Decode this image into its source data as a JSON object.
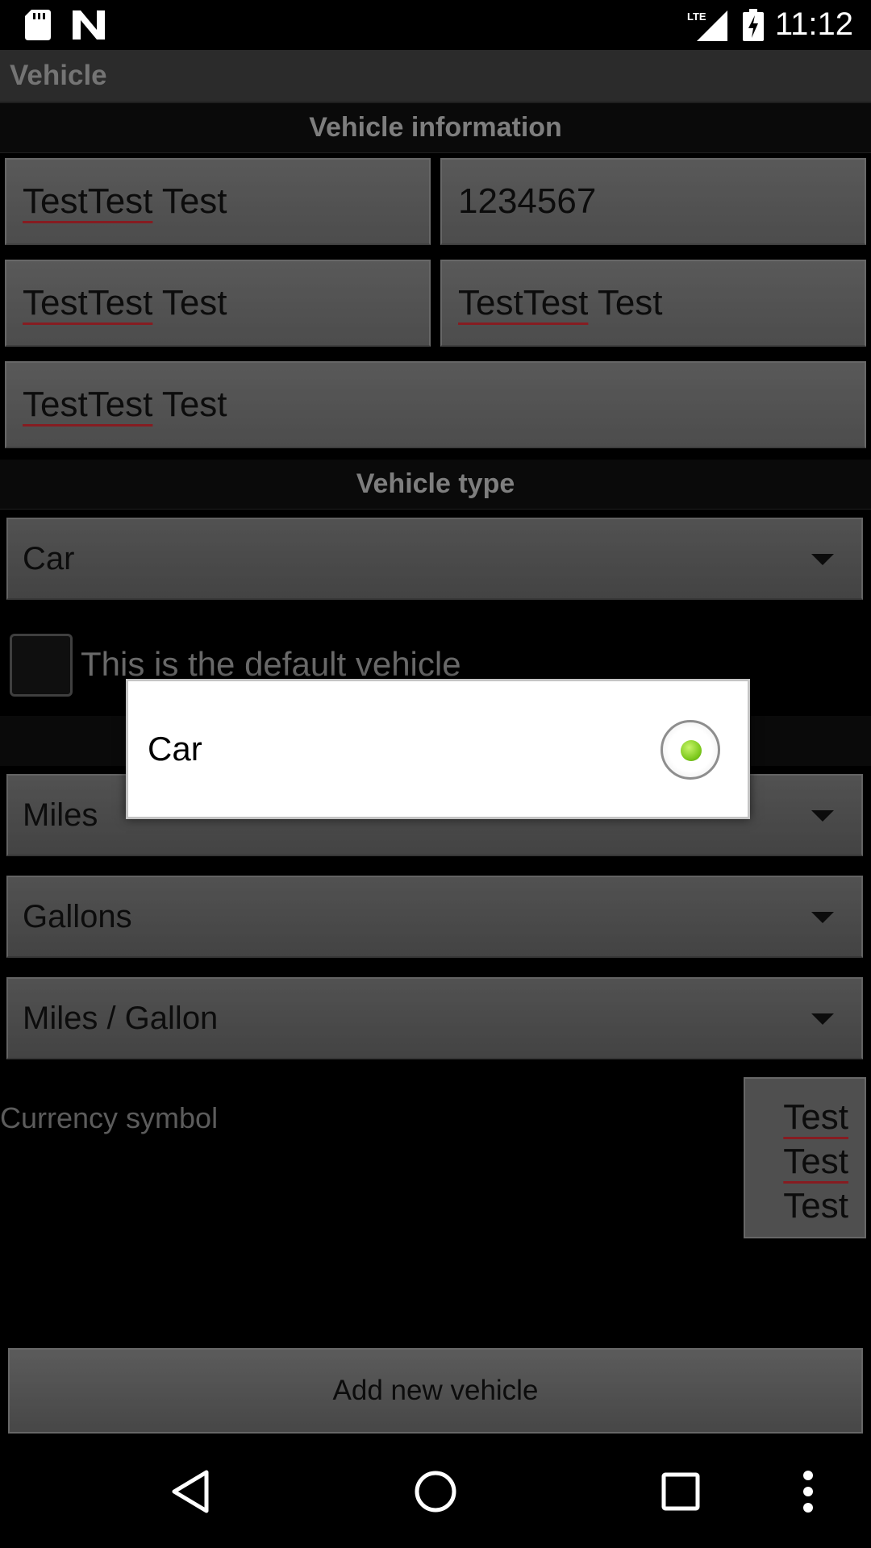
{
  "status_bar": {
    "time": "11:12",
    "network_label": "LTE",
    "icons": [
      "sd-card-icon",
      "n-logo-icon",
      "lte-signal-icon",
      "battery-charging-icon"
    ]
  },
  "action_bar": {
    "title": "Vehicle"
  },
  "vehicle_information": {
    "header": "Vehicle information",
    "fields": [
      {
        "value_misspelled": "TestTest",
        "value_rest": " Test"
      },
      {
        "value": "1234567"
      },
      {
        "value_misspelled": "TestTest",
        "value_rest": " Test"
      },
      {
        "value_misspelled": "TestTest",
        "value_rest": " Test"
      },
      {
        "value_misspelled": "TestTest",
        "value_rest": " Test"
      }
    ]
  },
  "vehicle_type": {
    "header": "Vehicle type",
    "selected": "Car",
    "default_checkbox_label": "This is the default vehicle",
    "default_checked": false
  },
  "units": {
    "distance": "Miles",
    "volume": "Gallons",
    "consumption": "Miles / Gallon"
  },
  "currency": {
    "label": "Currency symbol",
    "lines": [
      "Test",
      "Test",
      "Test"
    ]
  },
  "add_button_label": "Add new vehicle",
  "dialog": {
    "options": [
      {
        "label": "Car",
        "selected": true
      }
    ],
    "accent_color": "#7ac71a"
  },
  "nav": {
    "icons": [
      "back-icon",
      "home-icon",
      "recents-icon",
      "menu-icon"
    ]
  }
}
